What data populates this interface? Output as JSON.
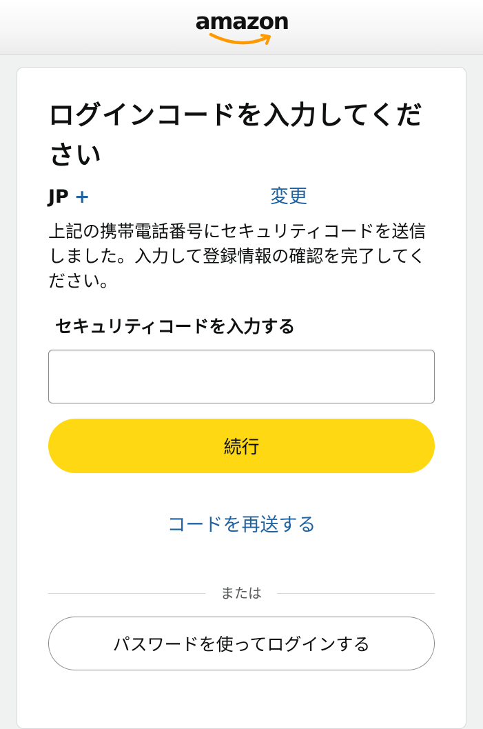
{
  "header": {
    "logo_text": "amazon",
    "logo_icon": "amazon-smile-logo"
  },
  "main": {
    "title": "ログインコードを入力してください",
    "phone": {
      "country_code": "JP",
      "plus": "+"
    },
    "change_link": "変更",
    "description": "上記の携帯電話番号にセキュリティコードを送信しました。入力して登録情報の確認を完了してください。",
    "code_field": {
      "label": "セキュリティコードを入力する",
      "value": "",
      "placeholder": ""
    },
    "continue_button": "続行",
    "resend_link": "コードを再送する",
    "divider_text": "または",
    "password_login_button": "パスワードを使ってログインする"
  },
  "colors": {
    "accent_yellow": "#ffd814",
    "link_blue": "#2162a1",
    "smile_orange": "#ff9900",
    "text_dark": "#0f1111"
  }
}
